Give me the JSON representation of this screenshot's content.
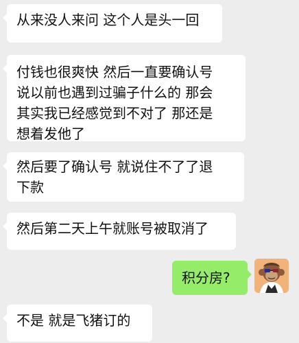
{
  "messages": [
    {
      "side": "left",
      "text": "从来没人来问 这个人是头一回"
    },
    {
      "side": "left",
      "text": "付钱也很爽快 然后一直要确认号\n说以前也遇到过骗子什么的 那会\n其实我已经感觉到不对了 那还是\n想着发他了"
    },
    {
      "side": "left",
      "text": "然后要了确认号 就说住不了了退\n下款"
    },
    {
      "side": "left",
      "text": "然后第二天上午就账号被取消了"
    },
    {
      "side": "right",
      "text": "积分房?"
    },
    {
      "side": "left",
      "text": "不是  就是飞猪订的"
    }
  ],
  "avatar": {
    "icon": "ape-avatar-icon",
    "background_color": "#f2b37a"
  },
  "colors": {
    "chat_background": "#ededed",
    "incoming_bubble": "#ffffff",
    "outgoing_bubble": "#95ec69",
    "text": "#111111"
  }
}
